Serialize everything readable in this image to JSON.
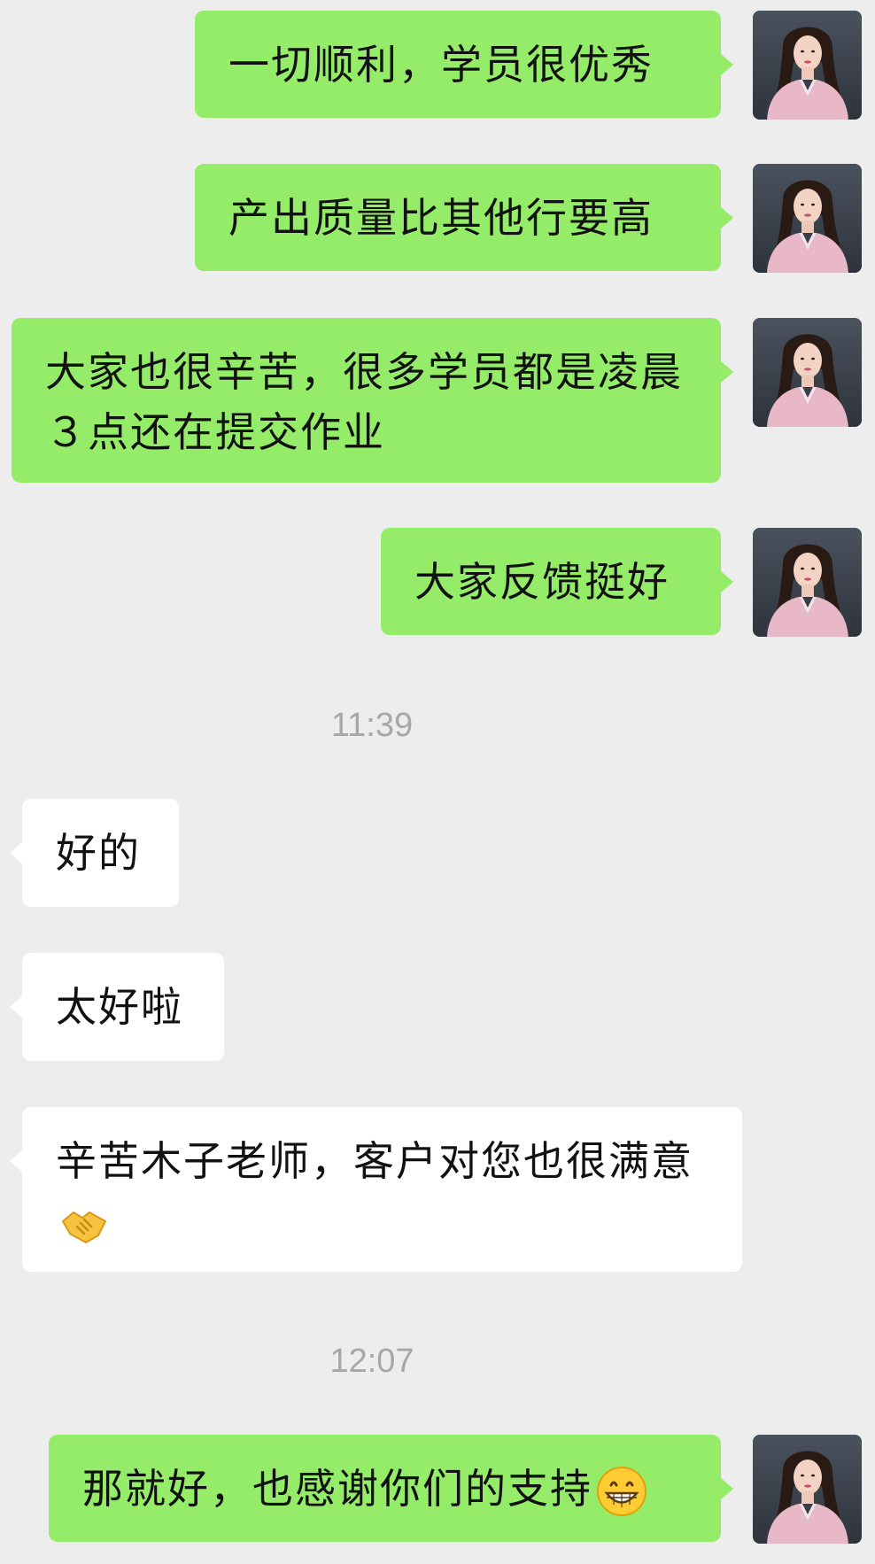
{
  "messages": [
    {
      "text": "一切顺利，学员很优秀"
    },
    {
      "text": "产出质量比其他行要高"
    },
    {
      "text": "大家也很辛苦，很多学员都是凌晨３点还在提交作业"
    },
    {
      "text": "大家反馈挺好"
    },
    {
      "text": "好的"
    },
    {
      "text": "太好啦"
    },
    {
      "text": "辛苦木子老师，客户对您也很满意"
    },
    {
      "text": "那就好，也感谢你们的支持"
    }
  ],
  "timestamps": [
    "11:39",
    "12:07"
  ],
  "emojis": {
    "handshake": "handshake-icon",
    "grin": "grinning-face-icon"
  },
  "colors": {
    "background": "#ededed",
    "outgoing_bubble": "#95ec69",
    "incoming_bubble": "#ffffff",
    "timestamp": "#a7a7a7"
  }
}
